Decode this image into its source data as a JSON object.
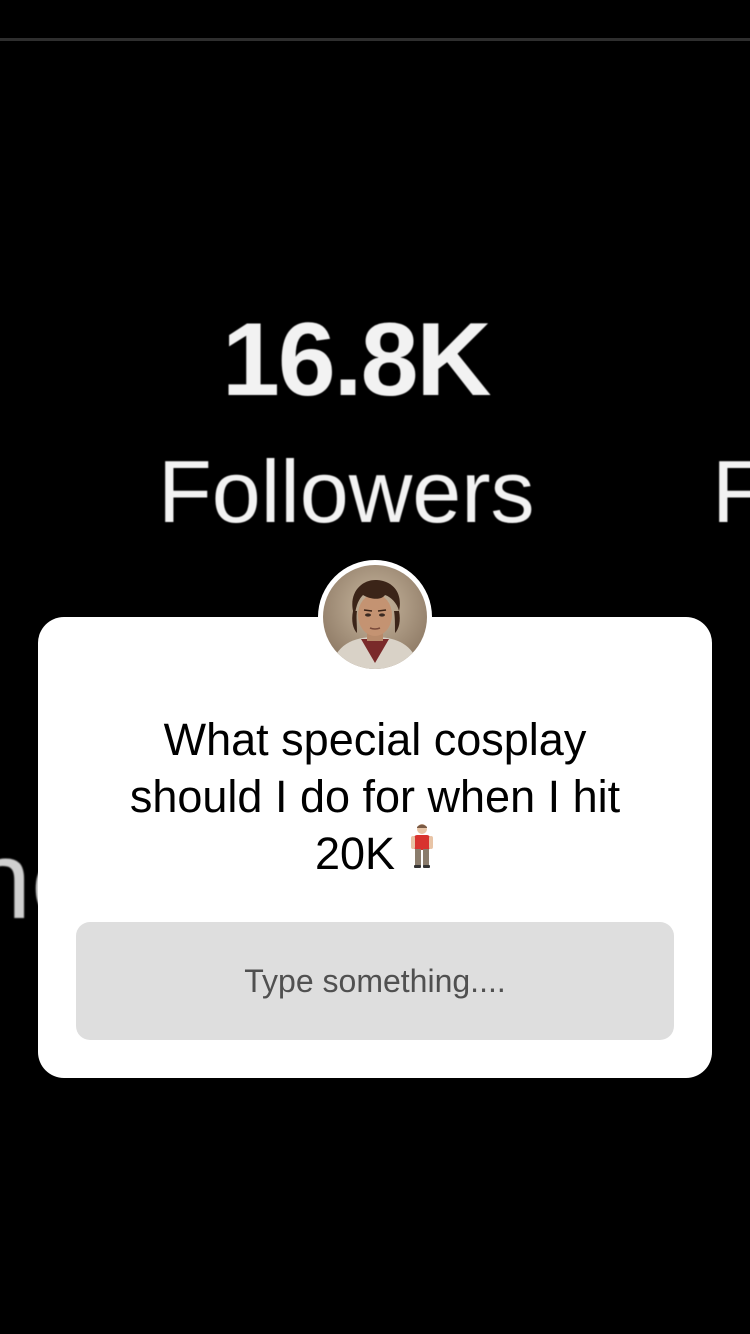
{
  "background": {
    "follower_count": "16.8K",
    "follower_label": "Followers",
    "next_label_partial": "F",
    "left_partial": "ne"
  },
  "question_sticker": {
    "avatar_icon": "profile-avatar",
    "question_line1": "What special cosplay",
    "question_line2": "should I do for when I hit",
    "question_line3": "20K",
    "emoji_icon": "person-standing-icon",
    "answer_placeholder": "Type something...."
  },
  "colors": {
    "background": "#000000",
    "card": "#ffffff",
    "answer_box": "#dedede",
    "placeholder_text": "#505050"
  }
}
